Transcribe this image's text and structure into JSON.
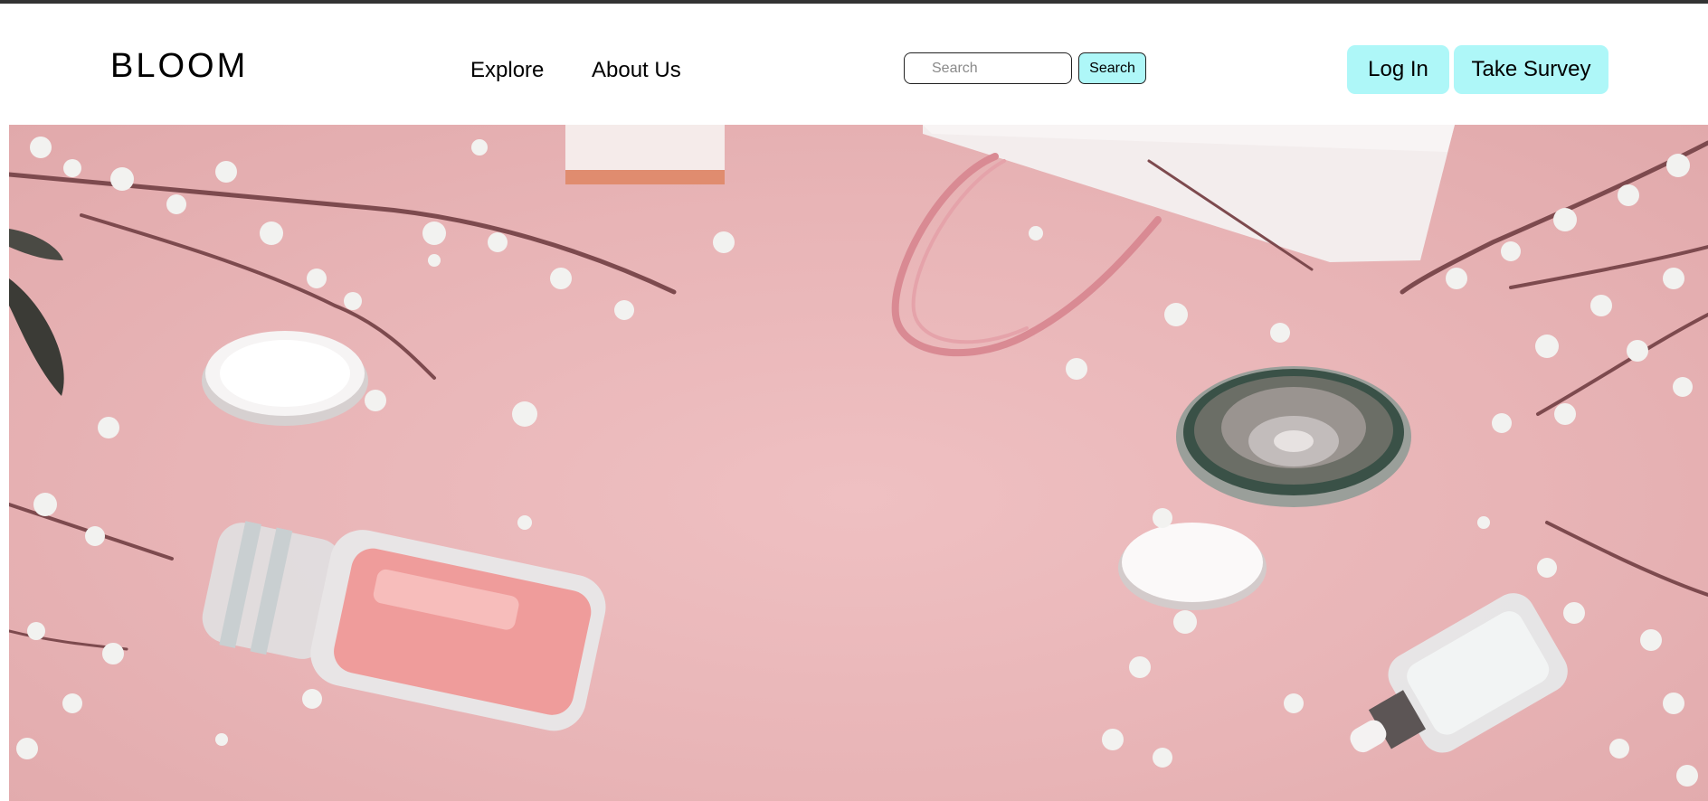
{
  "brand": {
    "logo": "BLOOM"
  },
  "nav": {
    "items": [
      {
        "label": "Explore"
      },
      {
        "label": "About Us"
      }
    ]
  },
  "search": {
    "placeholder": "Search",
    "value": "",
    "button_label": "Search"
  },
  "actions": {
    "login_label": "Log In",
    "survey_label": "Take Survey"
  },
  "colors": {
    "accent": "#aef7f8",
    "hero_background": "#e8b4b6",
    "top_strip": "#333333"
  },
  "hero": {
    "image_subject": "cosmetics flat lay with cherry blossoms on pink background"
  }
}
